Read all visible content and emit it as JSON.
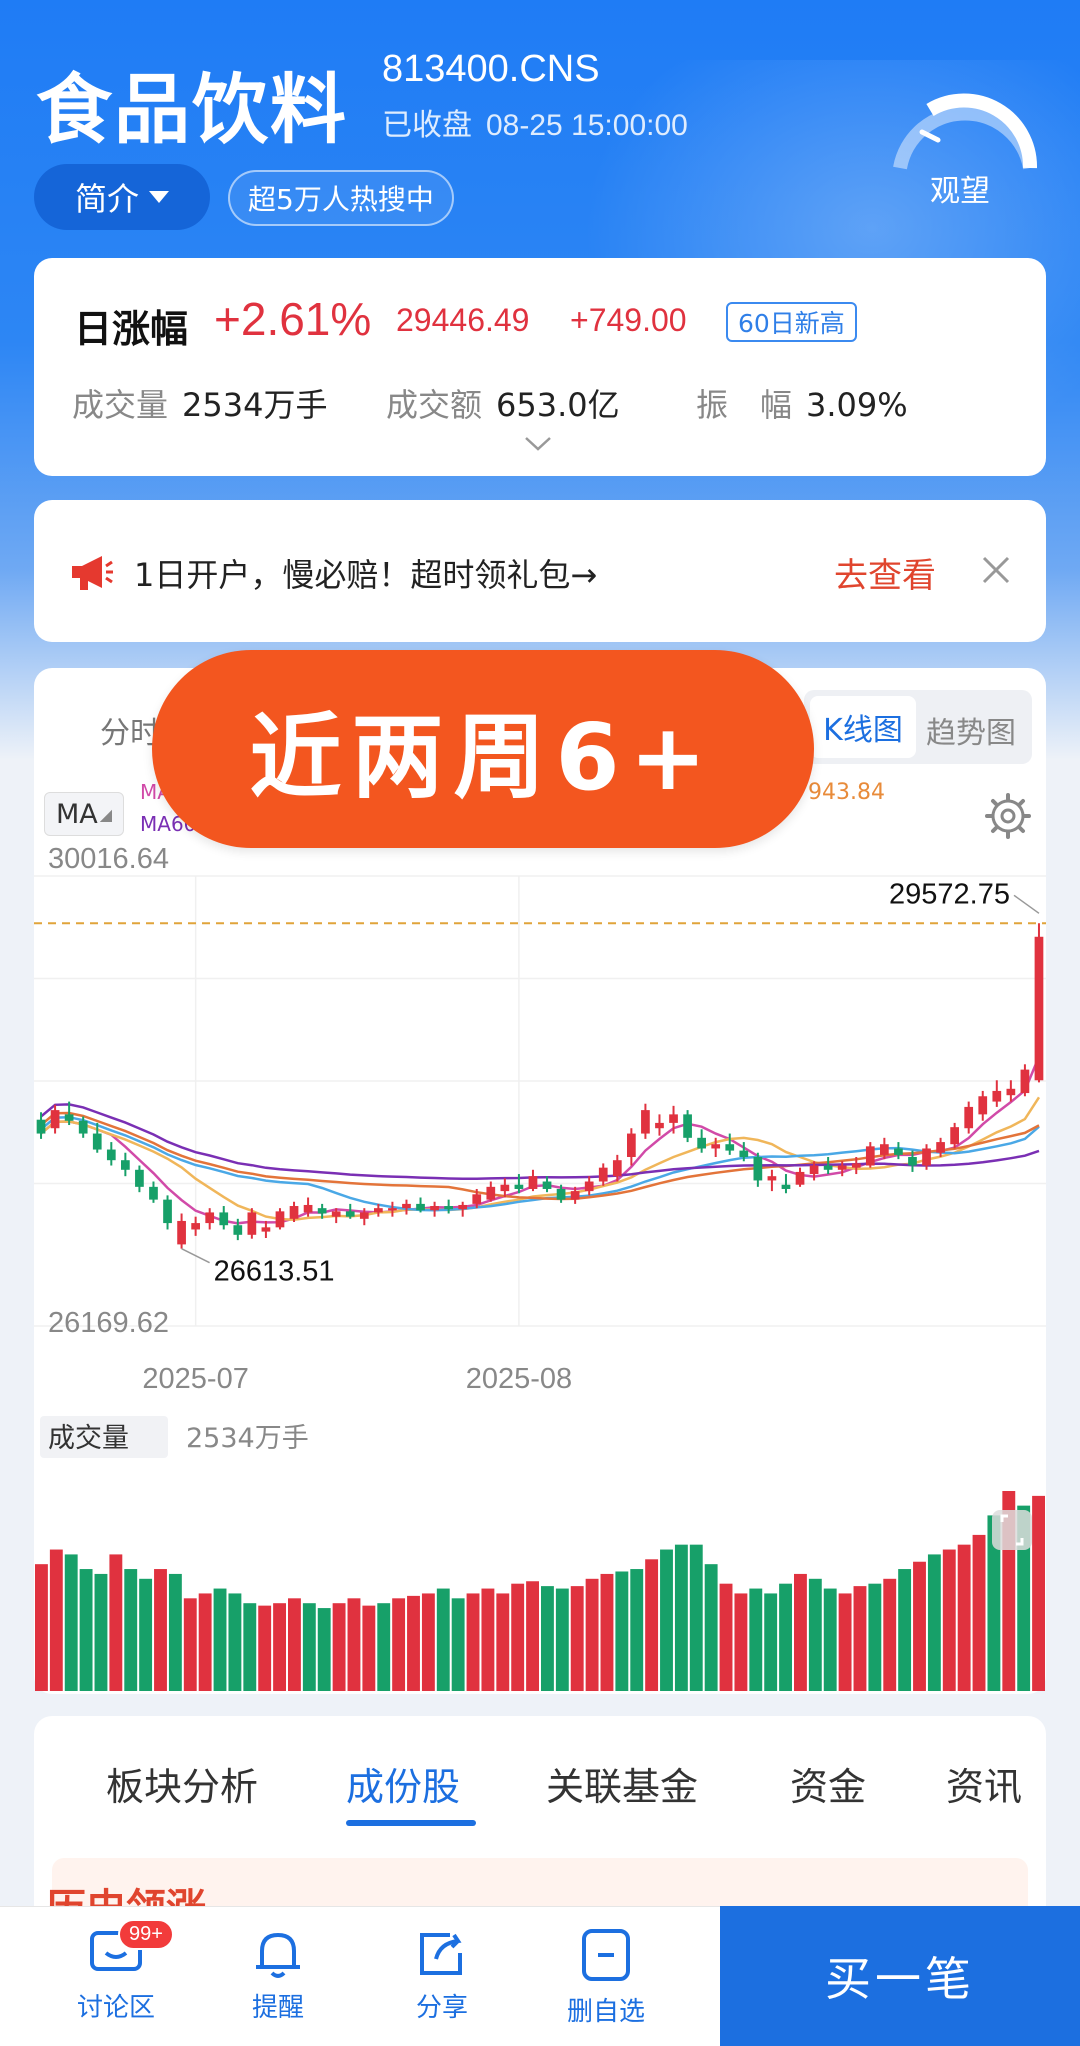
{
  "header": {
    "name": "食品饮料",
    "code": "813400.CNS",
    "status": "已收盘",
    "time": "08-25 15:00:00",
    "gauge_label": "观望",
    "intro_label": "简介",
    "hot_label": "超5万人热搜中"
  },
  "quote": {
    "label": "日涨幅",
    "pct": "+2.61%",
    "price": "29446.49",
    "change": "+749.00",
    "badge": "60日新高",
    "volume_key": "成交量",
    "volume_val": "2534万手",
    "amount_key": "成交额",
    "amount_val": "653.0亿",
    "amp_key": "振　幅",
    "amp_val": "3.09%"
  },
  "ad": {
    "text": "1日开户，慢必赔！超时领礼包→",
    "link": "去查看"
  },
  "chart_tabs": {
    "fenshi": "分时",
    "kline": "K线图",
    "trend": "趋势图",
    "ma_label": "MA",
    "ma5": "MA",
    "ma60": "MA60",
    "ma_value": "943.84"
  },
  "banner": {
    "text": "近两周6+"
  },
  "chart_data": {
    "type": "candlestick",
    "y_top_label": "30016.64",
    "y_bottom_label": "26169.62",
    "high_label": "29572.75",
    "low_label": "26613.51",
    "x_labels": [
      "2025-07",
      "2025-08"
    ],
    "ylim": [
      26169.62,
      30016.64
    ],
    "volume_label": "成交量",
    "volume_value": "2534万手",
    "candles": [
      [
        27730,
        27800,
        27550,
        27600
      ],
      [
        27650,
        27870,
        27600,
        27820
      ],
      [
        27780,
        27900,
        27680,
        27720
      ],
      [
        27720,
        27760,
        27560,
        27600
      ],
      [
        27600,
        27700,
        27420,
        27450
      ],
      [
        27450,
        27520,
        27300,
        27350
      ],
      [
        27350,
        27420,
        27200,
        27260
      ],
      [
        27260,
        27300,
        27050,
        27100
      ],
      [
        27100,
        27150,
        26950,
        26980
      ],
      [
        26980,
        27020,
        26700,
        26760
      ],
      [
        26560,
        26850,
        26520,
        26780
      ],
      [
        26700,
        26820,
        26640,
        26760
      ],
      [
        26760,
        26900,
        26700,
        26860
      ],
      [
        26860,
        26920,
        26700,
        26740
      ],
      [
        26740,
        26800,
        26600,
        26650
      ],
      [
        26650,
        26900,
        26613.51,
        26860
      ],
      [
        26680,
        26780,
        26620,
        26720
      ],
      [
        26720,
        26900,
        26700,
        26870
      ],
      [
        26800,
        26960,
        26770,
        26920
      ],
      [
        26860,
        27000,
        26820,
        26930
      ],
      [
        26900,
        26940,
        26800,
        26850
      ],
      [
        26820,
        26900,
        26760,
        26870
      ],
      [
        26870,
        26940,
        26800,
        26820
      ],
      [
        26800,
        26900,
        26740,
        26860
      ],
      [
        26860,
        26940,
        26820,
        26900
      ],
      [
        26880,
        26960,
        26820,
        26900
      ],
      [
        26900,
        26980,
        26840,
        26940
      ],
      [
        26940,
        27000,
        26860,
        26880
      ],
      [
        26880,
        26960,
        26820,
        26920
      ],
      [
        26920,
        26980,
        26850,
        26890
      ],
      [
        26890,
        26960,
        26820,
        26930
      ],
      [
        26940,
        27080,
        26900,
        27030
      ],
      [
        26980,
        27150,
        26960,
        27100
      ],
      [
        27060,
        27180,
        27000,
        27120
      ],
      [
        27120,
        27220,
        27040,
        27080
      ],
      [
        27080,
        27260,
        27060,
        27200
      ],
      [
        27150,
        27200,
        27050,
        27080
      ],
      [
        27080,
        27120,
        26950,
        26980
      ],
      [
        26980,
        27100,
        26940,
        27060
      ],
      [
        27060,
        27200,
        27020,
        27150
      ],
      [
        27150,
        27320,
        27110,
        27280
      ],
      [
        27200,
        27400,
        27150,
        27350
      ],
      [
        27380,
        27650,
        27300,
        27600
      ],
      [
        27600,
        27880,
        27550,
        27820
      ],
      [
        27650,
        27780,
        27580,
        27700
      ],
      [
        27700,
        27860,
        27600,
        27780
      ],
      [
        27780,
        27820,
        27520,
        27560
      ],
      [
        27560,
        27640,
        27420,
        27460
      ],
      [
        27460,
        27560,
        27380,
        27500
      ],
      [
        27500,
        27600,
        27400,
        27440
      ],
      [
        27440,
        27520,
        27340,
        27380
      ],
      [
        27380,
        27420,
        27100,
        27160
      ],
      [
        27160,
        27260,
        27060,
        27200
      ],
      [
        27120,
        27220,
        27040,
        27080
      ],
      [
        27120,
        27280,
        27100,
        27240
      ],
      [
        27220,
        27340,
        27160,
        27300
      ],
      [
        27300,
        27380,
        27220,
        27260
      ],
      [
        27260,
        27340,
        27200,
        27300
      ],
      [
        27280,
        27380,
        27220,
        27320
      ],
      [
        27300,
        27520,
        27280,
        27480
      ],
      [
        27400,
        27560,
        27360,
        27500
      ],
      [
        27460,
        27520,
        27360,
        27400
      ],
      [
        27380,
        27440,
        27240,
        27300
      ],
      [
        27300,
        27500,
        27260,
        27460
      ],
      [
        27420,
        27560,
        27380,
        27520
      ],
      [
        27500,
        27700,
        27460,
        27660
      ],
      [
        27650,
        27900,
        27600,
        27850
      ],
      [
        27780,
        28000,
        27720,
        27950
      ],
      [
        27900,
        28100,
        27850,
        28000
      ],
      [
        27960,
        28100,
        27900,
        28020
      ],
      [
        27980,
        28250,
        27950,
        28200
      ],
      [
        28100,
        29572.75,
        28080,
        29446.49
      ]
    ],
    "volumes": [
      [
        260,
        1
      ],
      [
        290,
        1
      ],
      [
        280,
        0
      ],
      [
        250,
        0
      ],
      [
        240,
        0
      ],
      [
        280,
        1
      ],
      [
        250,
        0
      ],
      [
        230,
        0
      ],
      [
        250,
        1
      ],
      [
        240,
        0
      ],
      [
        190,
        1
      ],
      [
        200,
        1
      ],
      [
        210,
        0
      ],
      [
        200,
        0
      ],
      [
        180,
        0
      ],
      [
        175,
        1
      ],
      [
        180,
        1
      ],
      [
        190,
        1
      ],
      [
        180,
        0
      ],
      [
        170,
        0
      ],
      [
        180,
        1
      ],
      [
        190,
        1
      ],
      [
        175,
        1
      ],
      [
        180,
        0
      ],
      [
        190,
        1
      ],
      [
        195,
        1
      ],
      [
        200,
        1
      ],
      [
        210,
        0
      ],
      [
        190,
        0
      ],
      [
        200,
        1
      ],
      [
        210,
        1
      ],
      [
        200,
        1
      ],
      [
        220,
        1
      ],
      [
        225,
        1
      ],
      [
        215,
        0
      ],
      [
        210,
        0
      ],
      [
        215,
        1
      ],
      [
        230,
        1
      ],
      [
        240,
        1
      ],
      [
        245,
        0
      ],
      [
        250,
        0
      ],
      [
        270,
        1
      ],
      [
        290,
        0
      ],
      [
        300,
        0
      ],
      [
        300,
        0
      ],
      [
        260,
        0
      ],
      [
        220,
        1
      ],
      [
        200,
        1
      ],
      [
        210,
        0
      ],
      [
        200,
        0
      ],
      [
        220,
        0
      ],
      [
        240,
        1
      ],
      [
        230,
        0
      ],
      [
        210,
        0
      ],
      [
        200,
        1
      ],
      [
        215,
        1
      ],
      [
        220,
        0
      ],
      [
        230,
        1
      ],
      [
        250,
        0
      ],
      [
        265,
        1
      ],
      [
        280,
        0
      ],
      [
        290,
        1
      ],
      [
        300,
        1
      ],
      [
        320,
        1
      ],
      [
        360,
        0
      ],
      [
        410,
        1
      ],
      [
        380,
        0
      ],
      [
        400,
        1
      ]
    ]
  },
  "sub_tabs": [
    "板块分析",
    "成份股",
    "关联基金",
    "资金",
    "资讯"
  ],
  "peek_text": "历史领涨",
  "bottom": {
    "discuss": "讨论区",
    "discuss_badge": "99+",
    "remind": "提醒",
    "share": "分享",
    "remove": "删自选",
    "buy": "买一笔"
  }
}
